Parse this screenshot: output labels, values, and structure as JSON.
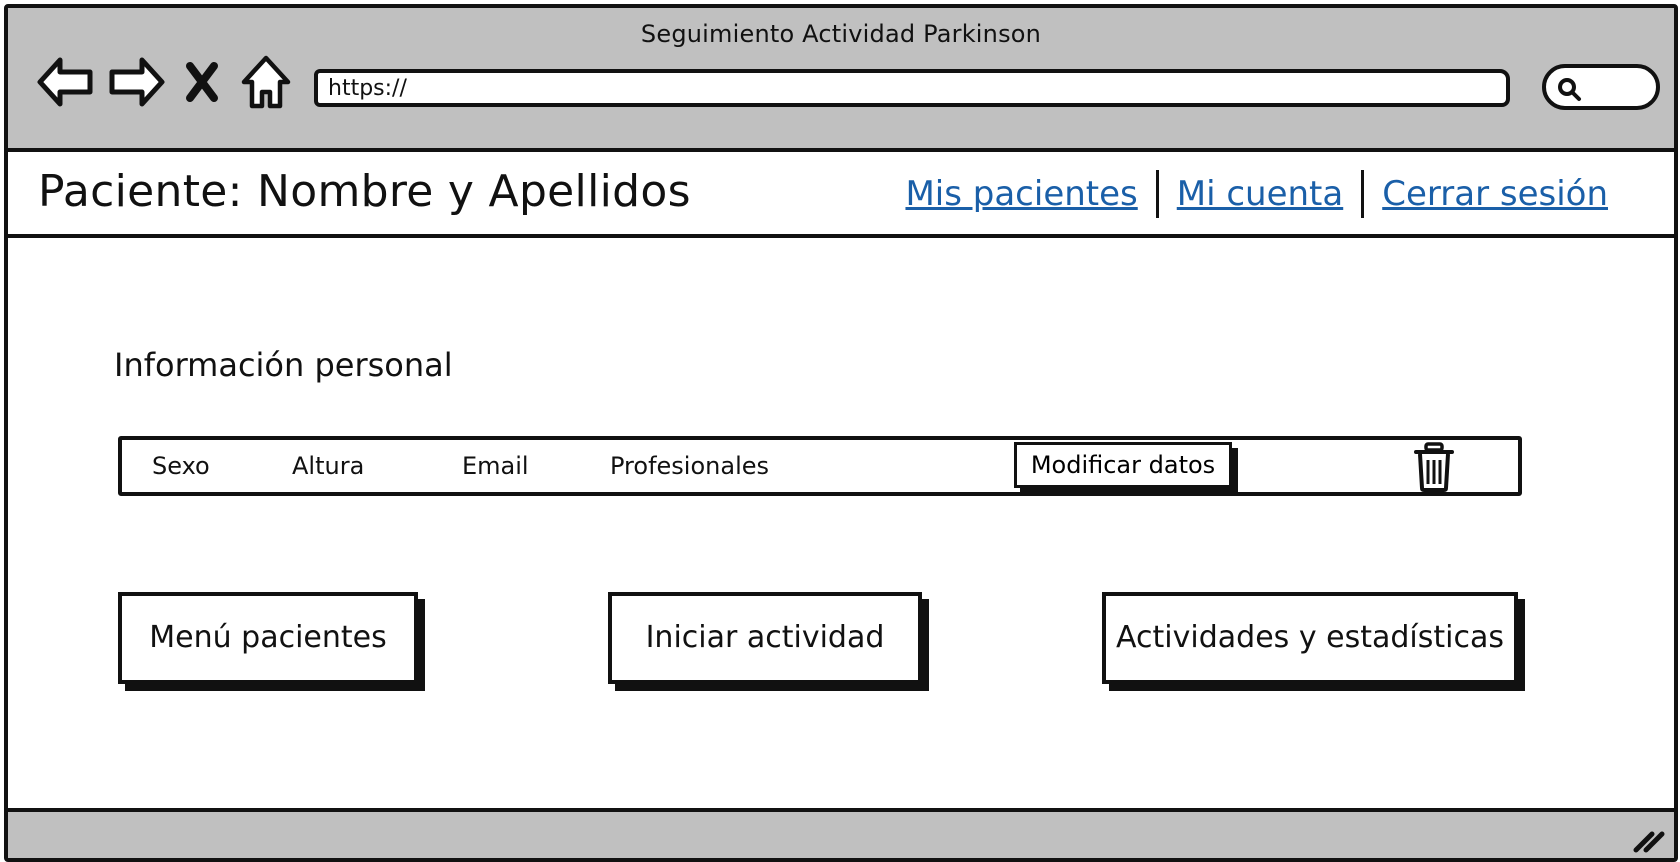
{
  "window": {
    "title": "Seguimiento Actividad Parkinson"
  },
  "browser": {
    "back_icon": "back-arrow-icon",
    "forward_icon": "forward-arrow-icon",
    "close_icon": "close-x-icon",
    "home_icon": "home-icon",
    "url_value": "https://",
    "search_icon": "magnifier-icon"
  },
  "header": {
    "title": "Paciente: Nombre y Apellidos",
    "links": [
      {
        "label": "Mis pacientes"
      },
      {
        "label": "Mi cuenta"
      },
      {
        "label": "Cerrar sesión"
      }
    ],
    "link_color": "#1a5fa8"
  },
  "personal_info": {
    "title": "Información personal",
    "fields": [
      {
        "label": "Sexo"
      },
      {
        "label": "Altura"
      },
      {
        "label": "Email"
      },
      {
        "label": "Profesionales"
      }
    ],
    "modify_label": "Modificar datos",
    "delete_icon": "trash-icon"
  },
  "actions": [
    {
      "label": "Menú pacientes"
    },
    {
      "label": "Iniciar actividad"
    },
    {
      "label": "Actividades y estadísticas"
    }
  ],
  "colors": {
    "chrome": "#c0c0c0",
    "stroke": "#111111"
  }
}
